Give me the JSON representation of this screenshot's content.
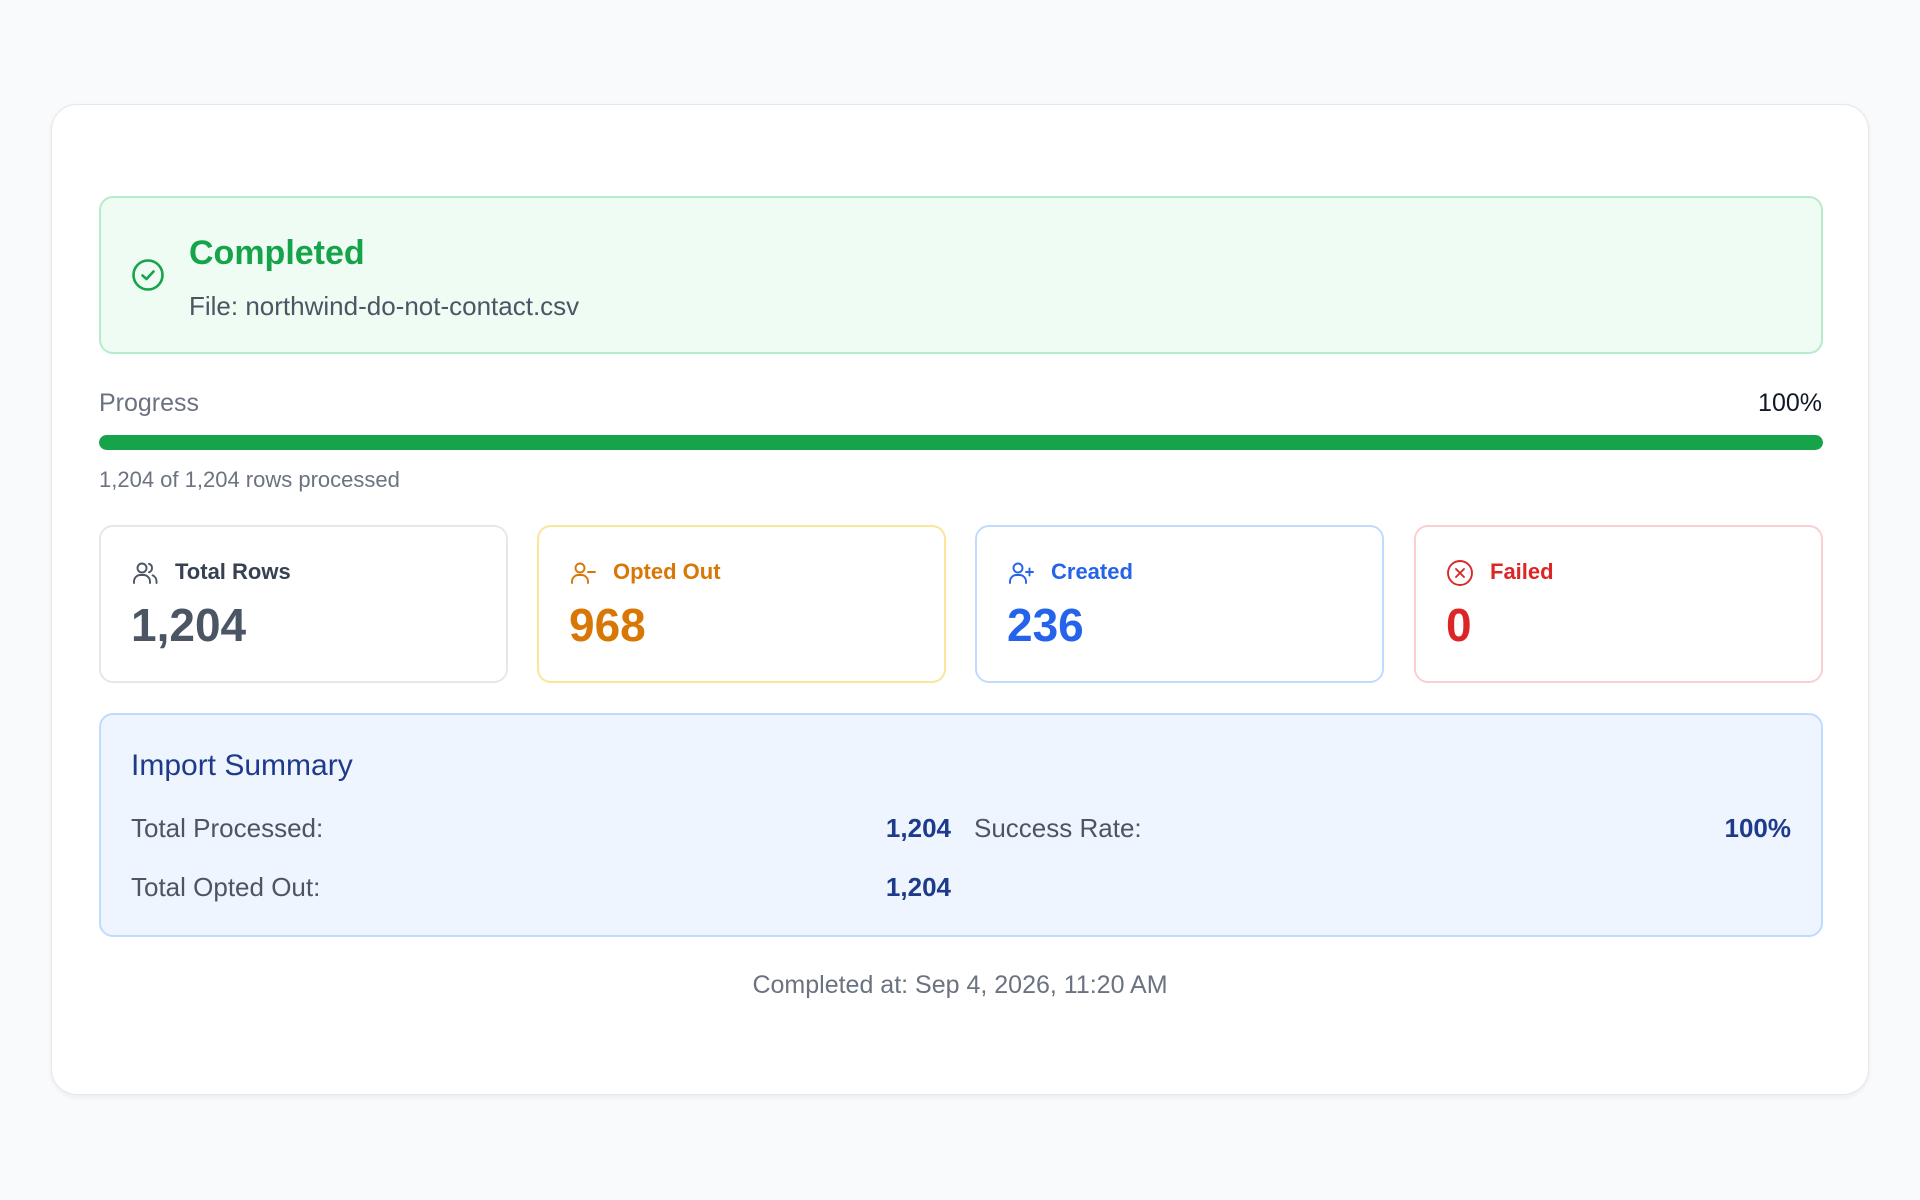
{
  "status": {
    "title": "Completed",
    "file": "File: northwind-do-not-contact.csv",
    "color": "#16a34a"
  },
  "progress": {
    "label": "Progress",
    "percent_text": "100%",
    "fraction": 1.0,
    "note": "1,204 of 1,204 rows processed"
  },
  "stats": [
    {
      "label": "Total Rows",
      "value": "1,204",
      "icon": "users-icon",
      "color": "#4b5563"
    },
    {
      "label": "Opted Out",
      "value": "968",
      "icon": "user-minus-icon",
      "color": "#d97706"
    },
    {
      "label": "Created",
      "value": "236",
      "icon": "user-plus-icon",
      "color": "#2563eb"
    },
    {
      "label": "Failed",
      "value": "0",
      "icon": "x-circle-icon",
      "color": "#dc2626"
    }
  ],
  "summary": {
    "title": "Import Summary",
    "total_processed_label": "Total Processed:",
    "total_processed_value": "1,204",
    "success_rate_label": "Success Rate:",
    "success_rate_value": "100%",
    "total_opted_out_label": "Total Opted Out:",
    "total_opted_out_value": "1,204"
  },
  "completed_at": "Completed at: Sep 4, 2026, 11:20 AM"
}
